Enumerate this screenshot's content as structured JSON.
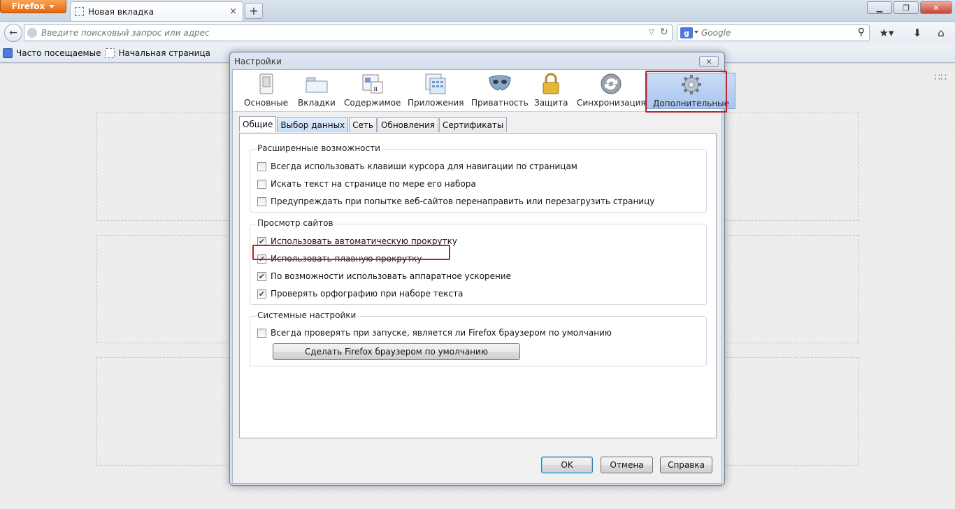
{
  "browser": {
    "menu_button": "Firefox",
    "tab_title": "Новая вкладка",
    "new_tab": "+",
    "url_placeholder": "Введите поисковый запрос или адрес",
    "search_engine_letter": "g",
    "search_placeholder": "Google",
    "window_controls": {
      "minimize": "▁",
      "maximize": "❐",
      "close": "✕"
    }
  },
  "bookmarks": [
    {
      "label": "Часто посещаемые",
      "icon": "most-visited-icon"
    },
    {
      "label": "Начальная страница",
      "icon": "page-icon"
    }
  ],
  "dialog": {
    "title": "Настройки",
    "close": "✕",
    "toolbar": [
      {
        "label": "Основные",
        "icon": "switch-icon"
      },
      {
        "label": "Вкладки",
        "icon": "tabs-icon"
      },
      {
        "label": "Содержимое",
        "icon": "content-icon"
      },
      {
        "label": "Приложения",
        "icon": "applications-icon"
      },
      {
        "label": "Приватность",
        "icon": "mask-icon"
      },
      {
        "label": "Защита",
        "icon": "padlock-icon"
      },
      {
        "label": "Синхронизация",
        "icon": "sync-icon"
      },
      {
        "label": "Дополнительные",
        "icon": "gear-icon"
      }
    ],
    "subtabs": [
      "Общие",
      "Выбор данных",
      "Сеть",
      "Обновления",
      "Сертификаты"
    ],
    "groups": {
      "advanced": {
        "legend": "Расширенные возможности",
        "items": [
          {
            "label": "Всегда использовать клавиши курсора для навигации по страницам",
            "checked": false
          },
          {
            "label": "Искать текст на странице по мере его набора",
            "checked": false
          },
          {
            "label": "Предупреждать при попытке веб-сайтов перенаправить или перезагрузить страницу",
            "checked": false
          }
        ]
      },
      "browsing": {
        "legend": "Просмотр сайтов",
        "items": [
          {
            "label": "Использовать автоматическую прокрутку",
            "checked": true
          },
          {
            "label": "Использовать плавную прокрутку",
            "checked": true
          },
          {
            "label": "По возможности использовать аппаратное ускорение",
            "checked": true
          },
          {
            "label": "Проверять орфографию при наборе текста",
            "checked": true
          }
        ]
      },
      "system": {
        "legend": "Системные настройки",
        "items": [
          {
            "label": "Всегда проверять при запуске, является ли Firefox браузером по умолчанию",
            "checked": false
          }
        ],
        "button": "Сделать Firefox браузером по умолчанию"
      }
    },
    "footer": {
      "ok": "OK",
      "cancel": "Отмена",
      "help": "Справка"
    }
  },
  "colors": {
    "highlight": "#c0202a",
    "firefox_orange": "#e3670c",
    "active_tab": "#a9c6ee"
  }
}
